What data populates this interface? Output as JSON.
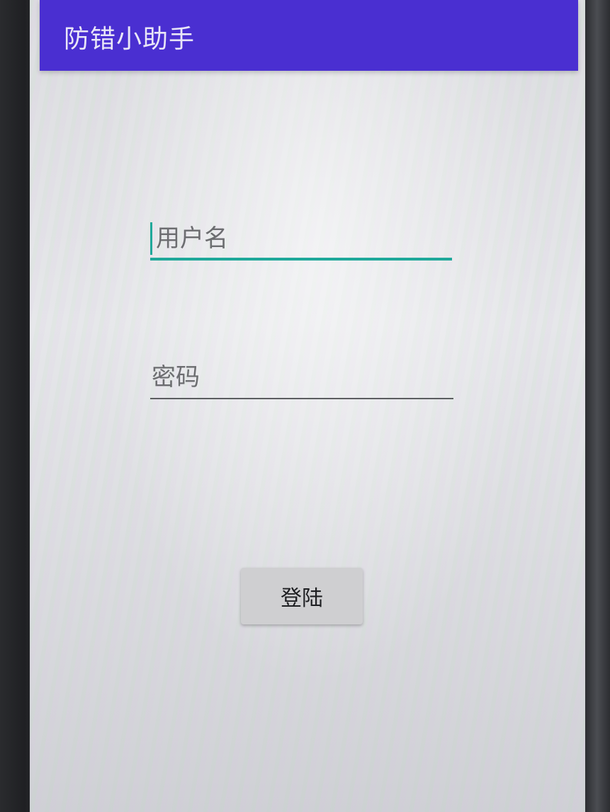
{
  "app": {
    "title": "防错小助手"
  },
  "login_form": {
    "username": {
      "placeholder": "用户名",
      "value": ""
    },
    "password": {
      "placeholder": "密码",
      "value": ""
    },
    "login_button_label": "登陆"
  },
  "colors": {
    "app_bar": "#4a2fd1",
    "focus_accent": "#1fa89a",
    "button_bg": "#cfcfd1"
  }
}
